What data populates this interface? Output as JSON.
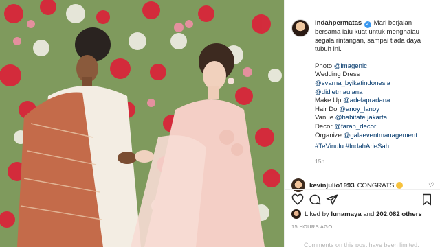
{
  "post": {
    "username": "indahpermatas",
    "caption_text": "Mari berjalan bersama lalu kuat untuk menghalau segala rintangan, sampai tiada daya tubuh ini.",
    "credits": [
      {
        "label": "Photo",
        "handle": "@imagenic"
      },
      {
        "label": "Wedding Dress",
        "handle": ""
      },
      {
        "label": "",
        "handle": "@svarna_byikatindonesia"
      },
      {
        "label": "",
        "handle": "@didietmaulana"
      },
      {
        "label": "Make Up",
        "handle": "@adelapradana"
      },
      {
        "label": "Hair Do",
        "handle": "@anoy_lanoy"
      },
      {
        "label": "Vanue",
        "handle": "@habitate.jakarta"
      },
      {
        "label": "Decor",
        "handle": "@farah_decor"
      },
      {
        "label": "Organize",
        "handle": "@galaeventmanagement"
      }
    ],
    "hashtags": "#TeVinulu #IndahArieSah",
    "caption_age": "15h"
  },
  "comment": {
    "username": "kevinjulio1993",
    "text": "CONGRATS"
  },
  "likes": {
    "prefix": "Liked by",
    "user": "lunamaya",
    "connector": "and",
    "count": "202,082 others"
  },
  "timestamp": "15 HOURS AGO",
  "comments_limited": "Comments on this post have been limited.",
  "icons": [
    "heart-icon",
    "comment-icon",
    "share-icon",
    "bookmark-icon",
    "verified-icon"
  ],
  "colors": {
    "link": "#00376b",
    "verified": "#3897f0",
    "muted": "#8e8e8e"
  }
}
